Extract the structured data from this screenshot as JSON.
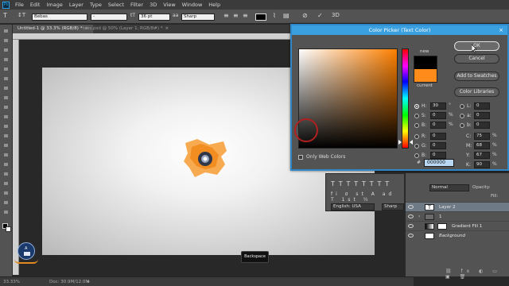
{
  "menu": {
    "logo": "Ps",
    "items": [
      "File",
      "Edit",
      "Image",
      "Layer",
      "Type",
      "Select",
      "Filter",
      "3D",
      "View",
      "Window",
      "Help"
    ]
  },
  "options_bar": {
    "font_family": "Bebas",
    "font_style": "-",
    "font_size": "36 pt",
    "antialias": "Sharp",
    "text_color": "#000000"
  },
  "tabs": [
    {
      "label": "Untitled-1 @ 33.3% (RGB/8) *",
      "active": true
    },
    {
      "label": "tess.psd @ 50% (Layer 1, RGB/8#) *",
      "active": false
    }
  ],
  "status": {
    "zoom": "33.33%",
    "doc": "Doc: 30.9M/12.0M"
  },
  "keycap": "Backspace",
  "color_picker": {
    "title": "Color Picker (Text Color)",
    "buttons": {
      "ok": "OK",
      "cancel": "Cancel",
      "add_swatches": "Add to Swatches",
      "libraries": "Color Libraries"
    },
    "new_label": "new",
    "current_label": "current",
    "new_color": "#000000",
    "current_color": "#ff8c1a",
    "hue_base": "#ff8000",
    "only_web_colors": "Only Web Colors",
    "hex_prefix": "#",
    "hex": "000000",
    "hsb": [
      {
        "key": "H:",
        "value": "30",
        "unit": "°",
        "selected": true
      },
      {
        "key": "S:",
        "value": "0",
        "unit": "%",
        "selected": false
      },
      {
        "key": "B:",
        "value": "0",
        "unit": "%",
        "selected": false
      }
    ],
    "rgb": [
      {
        "key": "R:",
        "value": "0"
      },
      {
        "key": "G:",
        "value": "0"
      },
      {
        "key": "B:",
        "value": "0"
      }
    ],
    "lab": [
      {
        "key": "L:",
        "value": "0"
      },
      {
        "key": "a:",
        "value": "0"
      },
      {
        "key": "b:",
        "value": "0"
      }
    ],
    "cmyk": [
      {
        "key": "C:",
        "value": "75",
        "unit": "%"
      },
      {
        "key": "M:",
        "value": "68",
        "unit": "%"
      },
      {
        "key": "Y:",
        "value": "67",
        "unit": "%"
      },
      {
        "key": "K:",
        "value": "90",
        "unit": "%"
      }
    ]
  },
  "char_panel": {
    "language": "English: USA",
    "aa": "Sharp"
  },
  "layers_panel": {
    "mode": "Normal",
    "opacity_label": "Opacity:",
    "fill_label": "Fill:",
    "layers": [
      {
        "name": "Layer 2",
        "selected": true
      },
      {
        "name": "1",
        "selected": false
      },
      {
        "name": "Gradient Fill 1",
        "selected": false
      },
      {
        "name": "Background",
        "selected": false
      }
    ]
  }
}
